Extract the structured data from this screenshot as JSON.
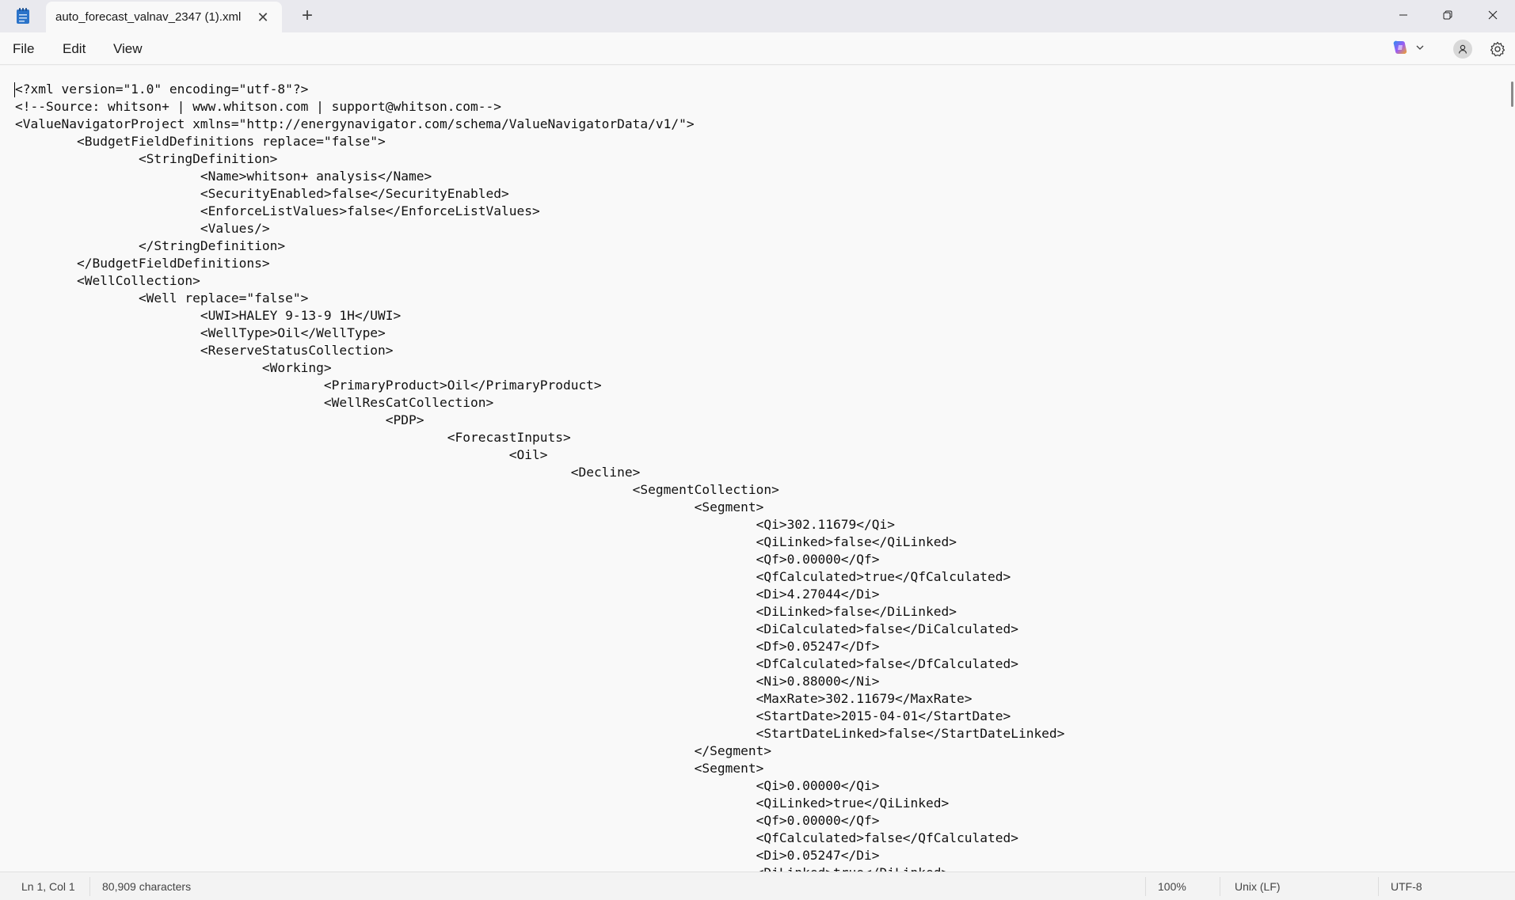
{
  "window": {
    "tab_title": "auto_forecast_valnav_2347 (1).xml",
    "new_tab_symbol": "+",
    "close_tab_symbol": "✕",
    "icons": [
      "notepad-icon",
      "close-icon",
      "plus-icon",
      "minimize-icon",
      "restore-icon",
      "window-close-icon"
    ]
  },
  "menu": {
    "file": "File",
    "edit": "Edit",
    "view": "View",
    "icons": [
      "copilot-icon",
      "chevron-down-icon",
      "account-icon",
      "gear-icon"
    ]
  },
  "editor": {
    "lines": [
      "<?xml version=\"1.0\" encoding=\"utf-8\"?>",
      "<!--Source: whitson+ | www.whitson.com | support@whitson.com-->",
      "<ValueNavigatorProject xmlns=\"http://energynavigator.com/schema/ValueNavigatorData/v1/\">",
      "\t<BudgetFieldDefinitions replace=\"false\">",
      "\t\t<StringDefinition>",
      "\t\t\t<Name>whitson+ analysis</Name>",
      "\t\t\t<SecurityEnabled>false</SecurityEnabled>",
      "\t\t\t<EnforceListValues>false</EnforceListValues>",
      "\t\t\t<Values/>",
      "\t\t</StringDefinition>",
      "\t</BudgetFieldDefinitions>",
      "\t<WellCollection>",
      "\t\t<Well replace=\"false\">",
      "\t\t\t<UWI>HALEY 9-13-9 1H</UWI>",
      "\t\t\t<WellType>Oil</WellType>",
      "\t\t\t<ReserveStatusCollection>",
      "\t\t\t\t<Working>",
      "\t\t\t\t\t<PrimaryProduct>Oil</PrimaryProduct>",
      "\t\t\t\t\t<WellResCatCollection>",
      "\t\t\t\t\t\t<PDP>",
      "\t\t\t\t\t\t\t<ForecastInputs>",
      "\t\t\t\t\t\t\t\t<Oil>",
      "\t\t\t\t\t\t\t\t\t<Decline>",
      "\t\t\t\t\t\t\t\t\t\t<SegmentCollection>",
      "\t\t\t\t\t\t\t\t\t\t\t<Segment>",
      "\t\t\t\t\t\t\t\t\t\t\t\t<Qi>302.11679</Qi>",
      "\t\t\t\t\t\t\t\t\t\t\t\t<QiLinked>false</QiLinked>",
      "\t\t\t\t\t\t\t\t\t\t\t\t<Qf>0.00000</Qf>",
      "\t\t\t\t\t\t\t\t\t\t\t\t<QfCalculated>true</QfCalculated>",
      "\t\t\t\t\t\t\t\t\t\t\t\t<Di>4.27044</Di>",
      "\t\t\t\t\t\t\t\t\t\t\t\t<DiLinked>false</DiLinked>",
      "\t\t\t\t\t\t\t\t\t\t\t\t<DiCalculated>false</DiCalculated>",
      "\t\t\t\t\t\t\t\t\t\t\t\t<Df>0.05247</Df>",
      "\t\t\t\t\t\t\t\t\t\t\t\t<DfCalculated>false</DfCalculated>",
      "\t\t\t\t\t\t\t\t\t\t\t\t<Ni>0.88000</Ni>",
      "\t\t\t\t\t\t\t\t\t\t\t\t<MaxRate>302.11679</MaxRate>",
      "\t\t\t\t\t\t\t\t\t\t\t\t<StartDate>2015-04-01</StartDate>",
      "\t\t\t\t\t\t\t\t\t\t\t\t<StartDateLinked>false</StartDateLinked>",
      "\t\t\t\t\t\t\t\t\t\t\t</Segment>",
      "\t\t\t\t\t\t\t\t\t\t\t<Segment>",
      "\t\t\t\t\t\t\t\t\t\t\t\t<Qi>0.00000</Qi>",
      "\t\t\t\t\t\t\t\t\t\t\t\t<QiLinked>true</QiLinked>",
      "\t\t\t\t\t\t\t\t\t\t\t\t<Qf>0.00000</Qf>",
      "\t\t\t\t\t\t\t\t\t\t\t\t<QfCalculated>false</QfCalculated>",
      "\t\t\t\t\t\t\t\t\t\t\t\t<Di>0.05247</Di>",
      "\t\t\t\t\t\t\t\t\t\t\t\t<DiLinked>true</DiLinked>"
    ]
  },
  "status": {
    "position": "Ln 1, Col 1",
    "characters": "80,909 characters",
    "zoom": "100%",
    "line_ending": "Unix (LF)",
    "encoding": "UTF-8"
  },
  "colors": {
    "titlebar_bg": "#e9e9ee",
    "editor_bg": "#f9f9f9",
    "app_icon": "#2b73c9"
  }
}
